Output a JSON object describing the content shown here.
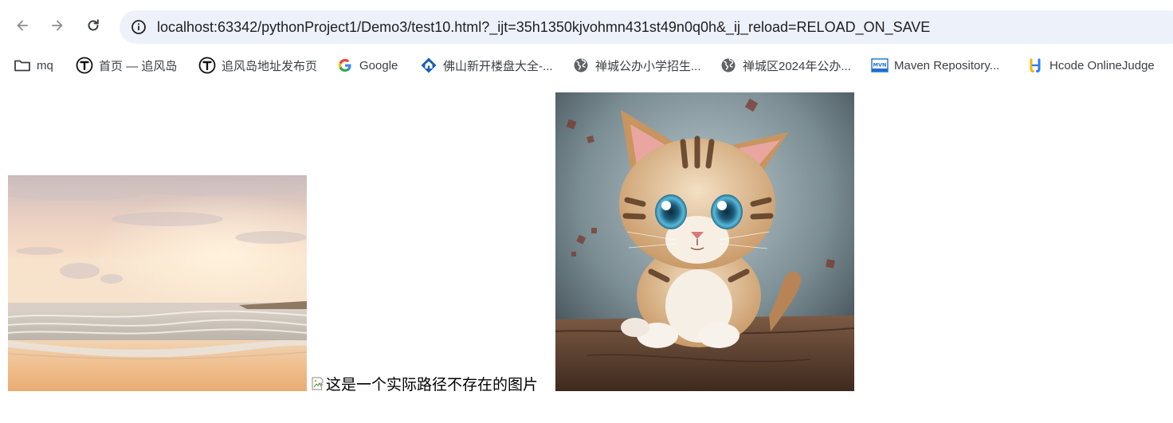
{
  "browser": {
    "url": "localhost:63342/pythonProject1/Demo3/test10.html?_ijt=35h1350kjvohmn431st49n0q0h&_ij_reload=RELOAD_ON_SAVE",
    "nav": {
      "back_icon": "arrow-left-icon",
      "forward_icon": "arrow-right-icon",
      "reload_icon": "reload-icon",
      "site_info_icon": "info-icon"
    },
    "bookmarks": [
      {
        "label": "mq",
        "icon": "folder-icon"
      },
      {
        "label": "首页 — 追风岛",
        "icon": "t-logo-icon"
      },
      {
        "label": "追风岛地址发布页",
        "icon": "t-logo-icon"
      },
      {
        "label": "Google",
        "icon": "google-icon"
      },
      {
        "label": "佛山新开楼盘大全-...",
        "icon": "house-icon"
      },
      {
        "label": "禅城公办小学招生...",
        "icon": "globe-icon"
      },
      {
        "label": "禅城区2024年公办...",
        "icon": "globe-icon"
      },
      {
        "label": "Maven Repository...",
        "icon": "mvn-icon"
      },
      {
        "label": "Hcode OnlineJudge",
        "icon": "hcode-icon"
      }
    ]
  },
  "page": {
    "beach_image": {
      "icon": "beach-sunset-image"
    },
    "broken_image": {
      "alt": "这是一个实际路径不存在的图片",
      "icon": "broken-image-icon"
    },
    "cat_image": {
      "icon": "kitten-image"
    }
  },
  "colors": {
    "omnibox_bg": "#edf1fa",
    "text": "#202124",
    "icon": "#5f6368"
  }
}
